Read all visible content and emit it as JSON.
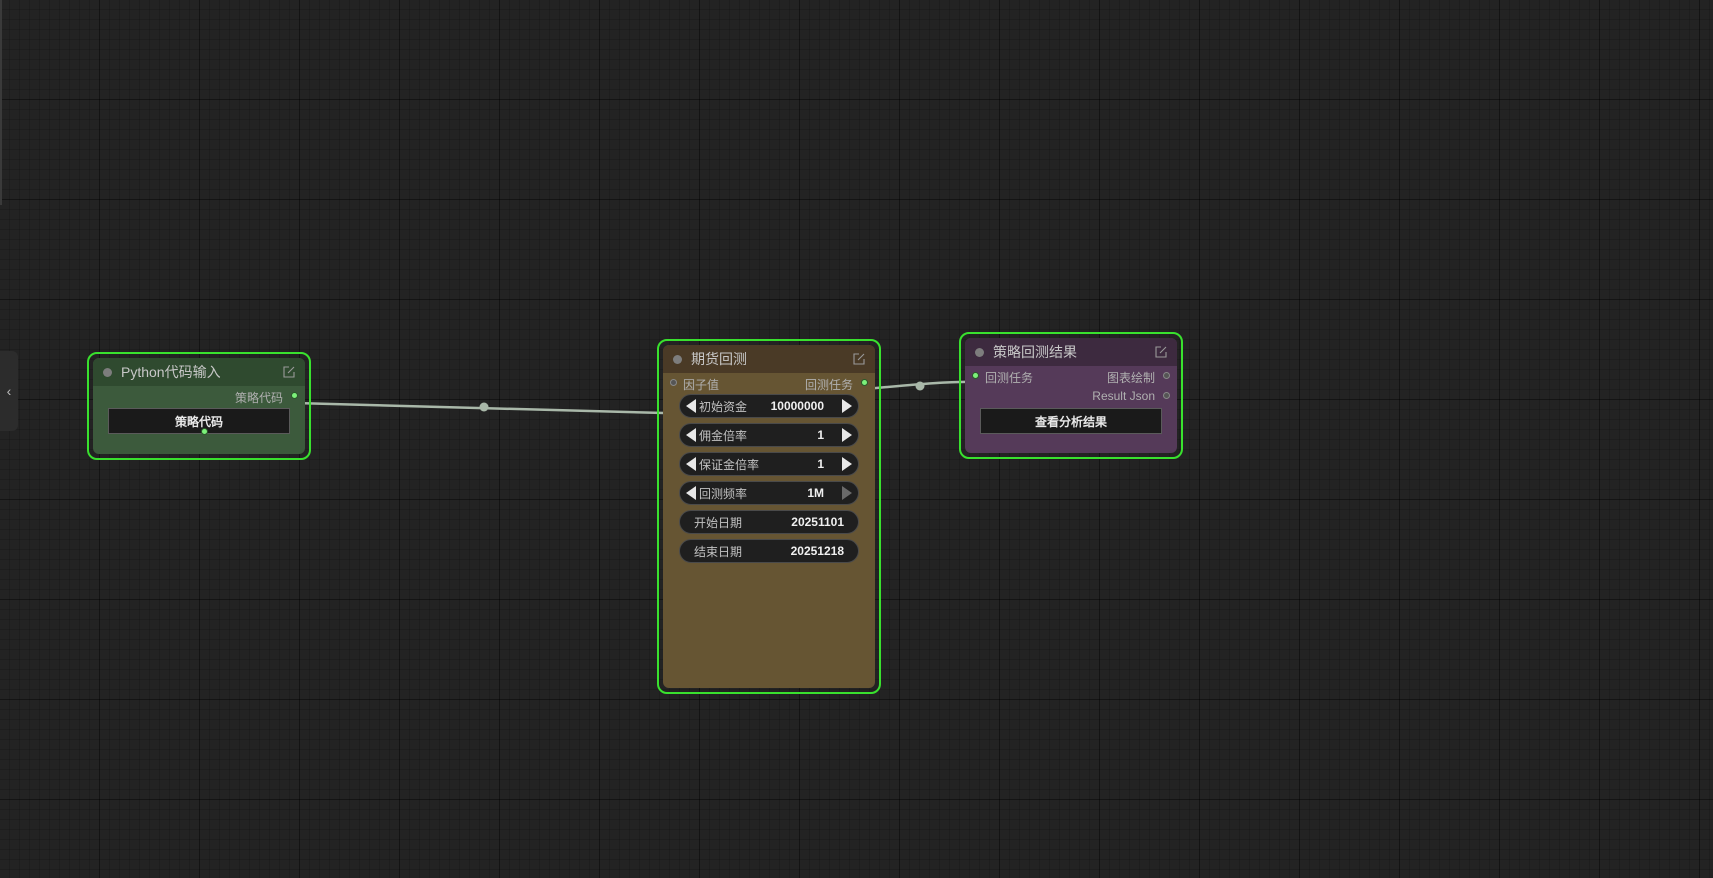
{
  "nodes": {
    "python_input": {
      "title": "Python代码输入",
      "output_label": "策略代码",
      "button_label": "策略代码",
      "header_color": "#2f4a2f",
      "body_color": "#3c5a3c"
    },
    "futures_backtest": {
      "title": "期货回测",
      "input_label": "因子值",
      "output_label": "回测任务",
      "header_color": "#4a3a26",
      "body_color": "#665533",
      "widgets": [
        {
          "label": "初始资金",
          "value": "10000000"
        },
        {
          "label": "佣金倍率",
          "value": "1"
        },
        {
          "label": "保证金倍率",
          "value": "1"
        },
        {
          "label": "回测频率",
          "value": "1M"
        },
        {
          "label": "开始日期",
          "value": "20251101"
        },
        {
          "label": "结束日期",
          "value": "20251218"
        }
      ]
    },
    "strategy_result": {
      "title": "策略回测结果",
      "input_label": "回测任务",
      "output_label_1": "图表绘制",
      "output_label_2": "Result Json",
      "button_label": "查看分析结果",
      "header_color": "#3d2a3f",
      "body_color": "#553a59"
    }
  },
  "selection_color": "#39e12e",
  "link_color": "#a9b8a9",
  "icons": {
    "sidebar_toggle": "chevron-left-icon",
    "edit": "edit-icon"
  }
}
